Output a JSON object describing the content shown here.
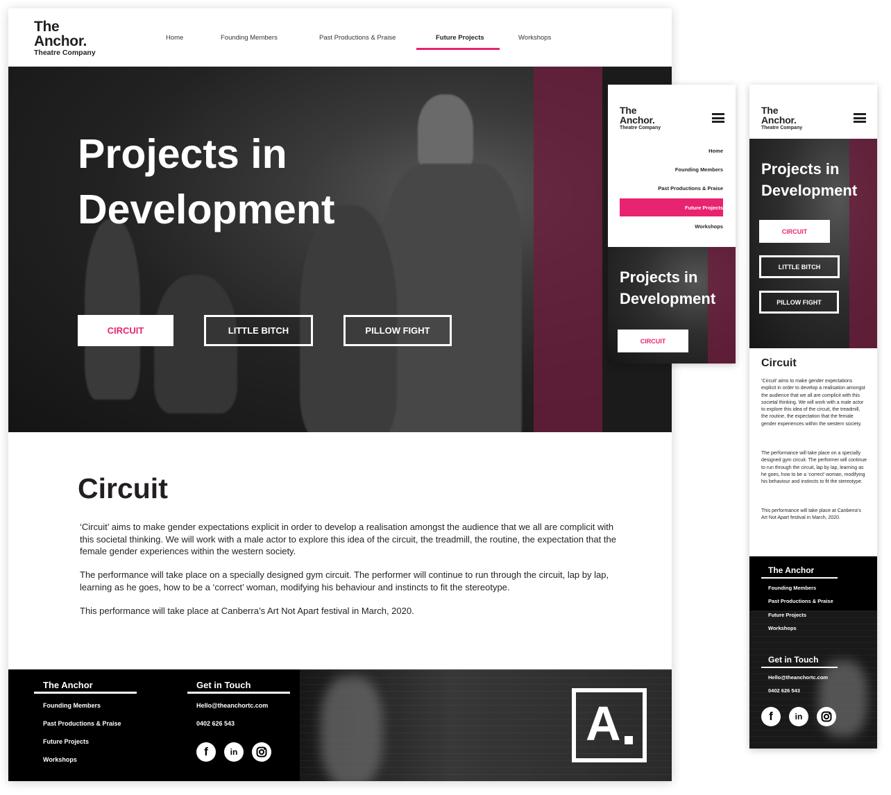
{
  "brand": {
    "line1": "The",
    "line2": "Anchor.",
    "line3": "Theatre Company",
    "accent": "#e8236f",
    "hero_stripe": "#6d1d3c"
  },
  "nav": {
    "items": [
      {
        "label": "Home",
        "active": false
      },
      {
        "label": "Founding Members",
        "active": false
      },
      {
        "label": "Past Productions & Praise",
        "active": false
      },
      {
        "label": "Future Projects",
        "active": true
      },
      {
        "label": "Workshops",
        "active": false
      }
    ]
  },
  "hero": {
    "title_line1": "Projects in",
    "title_line2": "Development",
    "buttons": [
      {
        "label": "CIRCUIT",
        "selected": true
      },
      {
        "label": "LITTLE BITCH",
        "selected": false
      },
      {
        "label": "PILLOW FIGHT",
        "selected": false
      }
    ]
  },
  "content": {
    "title": "Circuit",
    "paragraphs": [
      "‘Circuit’ aims to make gender expectations explicit in order to develop a realisation amongst the audience that we all are complicit with this societal thinking. We will work with a male actor to explore this idea of the circuit, the treadmill, the routine, the expectation that the female gender experiences within the western society.",
      "The performance will take place on a specially designed gym circuit. The performer will continue to run through the circuit, lap by lap, learning as he goes, how to be a ‘correct’ woman, modifying his behaviour and instincts to fit the stereotype.",
      "This performance will take place at Canberra’s Art Not Apart festival in March, 2020."
    ]
  },
  "footer": {
    "col1_title": "The Anchor",
    "col1_links": [
      "Founding Members",
      "Past Productions & Praise",
      "Future Projects",
      "Workshops"
    ],
    "col2_title": "Get in Touch",
    "email": "Hello@theanchortc.com",
    "phone": "0402 626 543",
    "social_icons": [
      "facebook-icon",
      "linkedin-icon",
      "instagram-icon"
    ],
    "logo_letter": "A"
  }
}
